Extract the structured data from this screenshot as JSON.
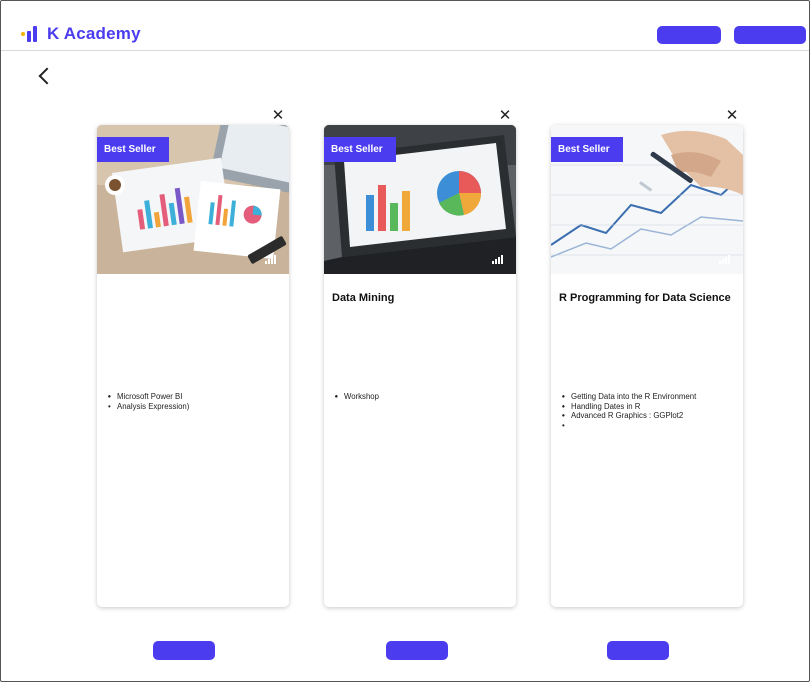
{
  "app": {
    "logo_text": "K Academy"
  },
  "header": {
    "login_label": "",
    "signup_label": ""
  },
  "page": {
    "title": ""
  },
  "cards": [
    {
      "badge": "Best Seller",
      "level": "",
      "title_line1": "",
      "title_line2": "",
      "price": "",
      "duration": "",
      "topics_label": "",
      "topics": [
        "",
        "",
        "",
        "",
        "",
        "",
        "",
        "",
        "",
        "",
        "",
        "Microsoft Power BI",
        "",
        "Analysis Expression)"
      ],
      "detail_label": ""
    },
    {
      "badge": "Best Seller",
      "level": "",
      "title_line1": "",
      "title_line2": "Data Mining",
      "price": "",
      "duration": "",
      "topics_label": "",
      "topics": [
        "",
        "",
        "",
        "",
        "",
        "",
        "",
        "",
        "",
        "",
        "",
        "",
        "",
        "",
        "Workshop"
      ],
      "detail_label": ""
    },
    {
      "badge": "Best Seller",
      "level": "",
      "title_line1": "R Programming for Data Science",
      "title_line2": "",
      "price": "",
      "duration": "",
      "topics_label": "",
      "topics": [
        "",
        "",
        "",
        "Getting Data into the R Environment",
        "",
        "",
        "",
        "",
        "Handling Dates in R",
        "",
        "",
        "Advanced R Graphics : GGPlot2",
        "",
        "",
        ""
      ],
      "detail_label": ""
    }
  ]
}
